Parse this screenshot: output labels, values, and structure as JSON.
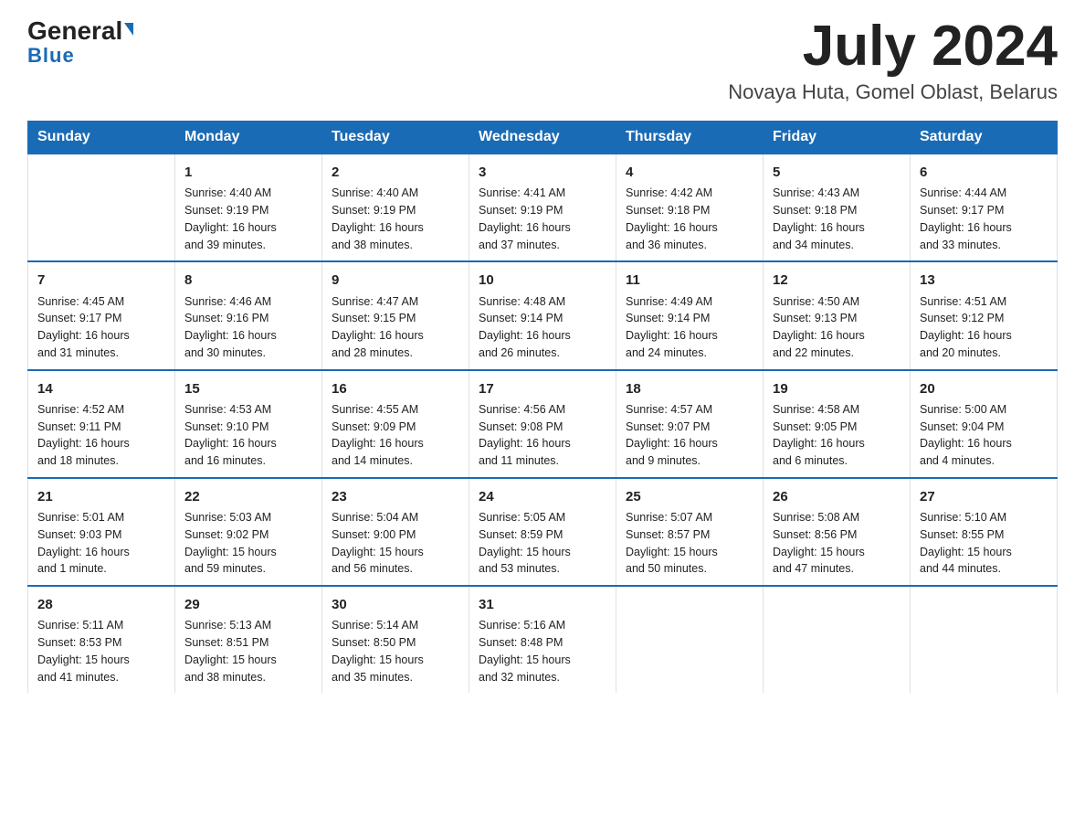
{
  "logo": {
    "general": "General",
    "arrow": "▲",
    "blue": "Blue"
  },
  "header": {
    "month": "July 2024",
    "location": "Novaya Huta, Gomel Oblast, Belarus"
  },
  "weekdays": [
    "Sunday",
    "Monday",
    "Tuesday",
    "Wednesday",
    "Thursday",
    "Friday",
    "Saturday"
  ],
  "weeks": [
    [
      {
        "day": "",
        "info": ""
      },
      {
        "day": "1",
        "info": "Sunrise: 4:40 AM\nSunset: 9:19 PM\nDaylight: 16 hours\nand 39 minutes."
      },
      {
        "day": "2",
        "info": "Sunrise: 4:40 AM\nSunset: 9:19 PM\nDaylight: 16 hours\nand 38 minutes."
      },
      {
        "day": "3",
        "info": "Sunrise: 4:41 AM\nSunset: 9:19 PM\nDaylight: 16 hours\nand 37 minutes."
      },
      {
        "day": "4",
        "info": "Sunrise: 4:42 AM\nSunset: 9:18 PM\nDaylight: 16 hours\nand 36 minutes."
      },
      {
        "day": "5",
        "info": "Sunrise: 4:43 AM\nSunset: 9:18 PM\nDaylight: 16 hours\nand 34 minutes."
      },
      {
        "day": "6",
        "info": "Sunrise: 4:44 AM\nSunset: 9:17 PM\nDaylight: 16 hours\nand 33 minutes."
      }
    ],
    [
      {
        "day": "7",
        "info": "Sunrise: 4:45 AM\nSunset: 9:17 PM\nDaylight: 16 hours\nand 31 minutes."
      },
      {
        "day": "8",
        "info": "Sunrise: 4:46 AM\nSunset: 9:16 PM\nDaylight: 16 hours\nand 30 minutes."
      },
      {
        "day": "9",
        "info": "Sunrise: 4:47 AM\nSunset: 9:15 PM\nDaylight: 16 hours\nand 28 minutes."
      },
      {
        "day": "10",
        "info": "Sunrise: 4:48 AM\nSunset: 9:14 PM\nDaylight: 16 hours\nand 26 minutes."
      },
      {
        "day": "11",
        "info": "Sunrise: 4:49 AM\nSunset: 9:14 PM\nDaylight: 16 hours\nand 24 minutes."
      },
      {
        "day": "12",
        "info": "Sunrise: 4:50 AM\nSunset: 9:13 PM\nDaylight: 16 hours\nand 22 minutes."
      },
      {
        "day": "13",
        "info": "Sunrise: 4:51 AM\nSunset: 9:12 PM\nDaylight: 16 hours\nand 20 minutes."
      }
    ],
    [
      {
        "day": "14",
        "info": "Sunrise: 4:52 AM\nSunset: 9:11 PM\nDaylight: 16 hours\nand 18 minutes."
      },
      {
        "day": "15",
        "info": "Sunrise: 4:53 AM\nSunset: 9:10 PM\nDaylight: 16 hours\nand 16 minutes."
      },
      {
        "day": "16",
        "info": "Sunrise: 4:55 AM\nSunset: 9:09 PM\nDaylight: 16 hours\nand 14 minutes."
      },
      {
        "day": "17",
        "info": "Sunrise: 4:56 AM\nSunset: 9:08 PM\nDaylight: 16 hours\nand 11 minutes."
      },
      {
        "day": "18",
        "info": "Sunrise: 4:57 AM\nSunset: 9:07 PM\nDaylight: 16 hours\nand 9 minutes."
      },
      {
        "day": "19",
        "info": "Sunrise: 4:58 AM\nSunset: 9:05 PM\nDaylight: 16 hours\nand 6 minutes."
      },
      {
        "day": "20",
        "info": "Sunrise: 5:00 AM\nSunset: 9:04 PM\nDaylight: 16 hours\nand 4 minutes."
      }
    ],
    [
      {
        "day": "21",
        "info": "Sunrise: 5:01 AM\nSunset: 9:03 PM\nDaylight: 16 hours\nand 1 minute."
      },
      {
        "day": "22",
        "info": "Sunrise: 5:03 AM\nSunset: 9:02 PM\nDaylight: 15 hours\nand 59 minutes."
      },
      {
        "day": "23",
        "info": "Sunrise: 5:04 AM\nSunset: 9:00 PM\nDaylight: 15 hours\nand 56 minutes."
      },
      {
        "day": "24",
        "info": "Sunrise: 5:05 AM\nSunset: 8:59 PM\nDaylight: 15 hours\nand 53 minutes."
      },
      {
        "day": "25",
        "info": "Sunrise: 5:07 AM\nSunset: 8:57 PM\nDaylight: 15 hours\nand 50 minutes."
      },
      {
        "day": "26",
        "info": "Sunrise: 5:08 AM\nSunset: 8:56 PM\nDaylight: 15 hours\nand 47 minutes."
      },
      {
        "day": "27",
        "info": "Sunrise: 5:10 AM\nSunset: 8:55 PM\nDaylight: 15 hours\nand 44 minutes."
      }
    ],
    [
      {
        "day": "28",
        "info": "Sunrise: 5:11 AM\nSunset: 8:53 PM\nDaylight: 15 hours\nand 41 minutes."
      },
      {
        "day": "29",
        "info": "Sunrise: 5:13 AM\nSunset: 8:51 PM\nDaylight: 15 hours\nand 38 minutes."
      },
      {
        "day": "30",
        "info": "Sunrise: 5:14 AM\nSunset: 8:50 PM\nDaylight: 15 hours\nand 35 minutes."
      },
      {
        "day": "31",
        "info": "Sunrise: 5:16 AM\nSunset: 8:48 PM\nDaylight: 15 hours\nand 32 minutes."
      },
      {
        "day": "",
        "info": ""
      },
      {
        "day": "",
        "info": ""
      },
      {
        "day": "",
        "info": ""
      }
    ]
  ]
}
